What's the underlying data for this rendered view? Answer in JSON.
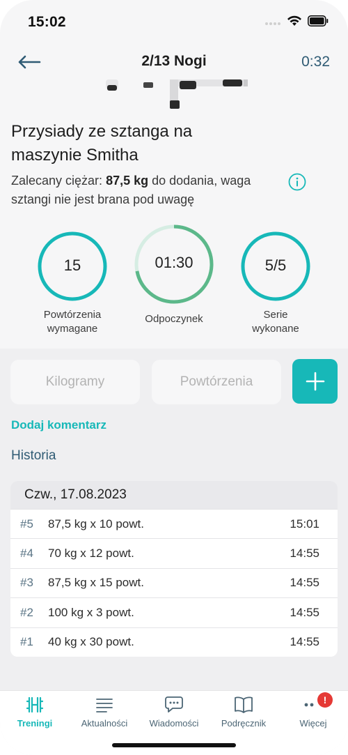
{
  "status": {
    "time": "15:02"
  },
  "nav": {
    "title": "2/13 Nogi",
    "timer": "0:32"
  },
  "exercise": {
    "title": "Przysiady ze sztanga na maszynie Smitha",
    "hint_prefix": "Zalecany ciężar: ",
    "hint_weight": "87,5 kg",
    "hint_suffix": " do dodania, waga sztangi nie jest brana pod uwagę"
  },
  "rings": {
    "reps": {
      "value": "15",
      "label_line1": "Powtórzenia",
      "label_line2": "wymagane"
    },
    "rest": {
      "value": "01:30",
      "label": "Odpoczynek",
      "progress": 0.72
    },
    "sets": {
      "value": "5/5",
      "label_line1": "Serie",
      "label_line2": "wykonane"
    }
  },
  "inputs": {
    "kg_placeholder": "Kilogramy",
    "reps_placeholder": "Powtórzenia"
  },
  "add_comment": "Dodaj komentarz",
  "history": {
    "title": "Historia",
    "date": "Czw., 17.08.2023",
    "rows": [
      {
        "idx": "#5",
        "desc": "87,5 kg x 10 powt.",
        "time": "15:01"
      },
      {
        "idx": "#4",
        "desc": "70 kg x 12 powt.",
        "time": "14:55"
      },
      {
        "idx": "#3",
        "desc": "87,5 kg x 15 powt.",
        "time": "14:55"
      },
      {
        "idx": "#2",
        "desc": "100 kg x 3 powt.",
        "time": "14:55"
      },
      {
        "idx": "#1",
        "desc": "40 kg x 30 powt.",
        "time": "14:55"
      }
    ]
  },
  "tabs": [
    {
      "label": "Treningi",
      "icon": "dumbbell-icon",
      "active": true
    },
    {
      "label": "Aktualności",
      "icon": "news-icon"
    },
    {
      "label": "Wiadomości",
      "icon": "chat-icon"
    },
    {
      "label": "Podręcznik",
      "icon": "book-icon"
    },
    {
      "label": "Więcej",
      "icon": "more-icon",
      "badge": "!"
    }
  ],
  "colors": {
    "accent": "#17b8b8",
    "rest_ring": "#5cb88a",
    "nav_blue": "#2f5b74",
    "badge": "#e53935"
  }
}
